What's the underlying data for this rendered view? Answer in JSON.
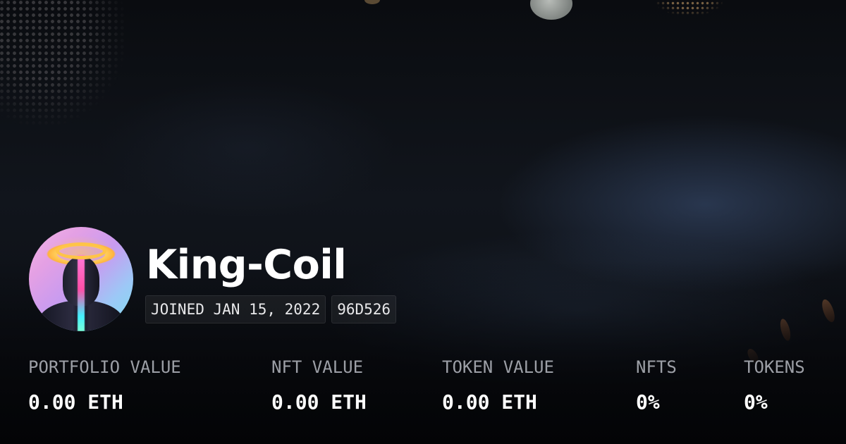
{
  "profile": {
    "username": "King-Coil",
    "joined": "JOINED JAN 15, 2022",
    "address_short": "96D526"
  },
  "stats": [
    {
      "label": "PORTFOLIO VALUE",
      "value": "0.00 ETH"
    },
    {
      "label": "NFT VALUE",
      "value": "0.00 ETH"
    },
    {
      "label": "TOKEN VALUE",
      "value": "0.00 ETH"
    },
    {
      "label": "NFTS",
      "value": "0%"
    },
    {
      "label": "TOKENS",
      "value": "0%"
    }
  ],
  "colors": {
    "text_primary": "#ffffff",
    "text_muted": "#9c9fa6",
    "background": "#0b0d12",
    "avatar_halo": "#ffc447",
    "avatar_beam": "#ff4fa8"
  },
  "icons": {
    "avatar": "profile-avatar-image"
  }
}
